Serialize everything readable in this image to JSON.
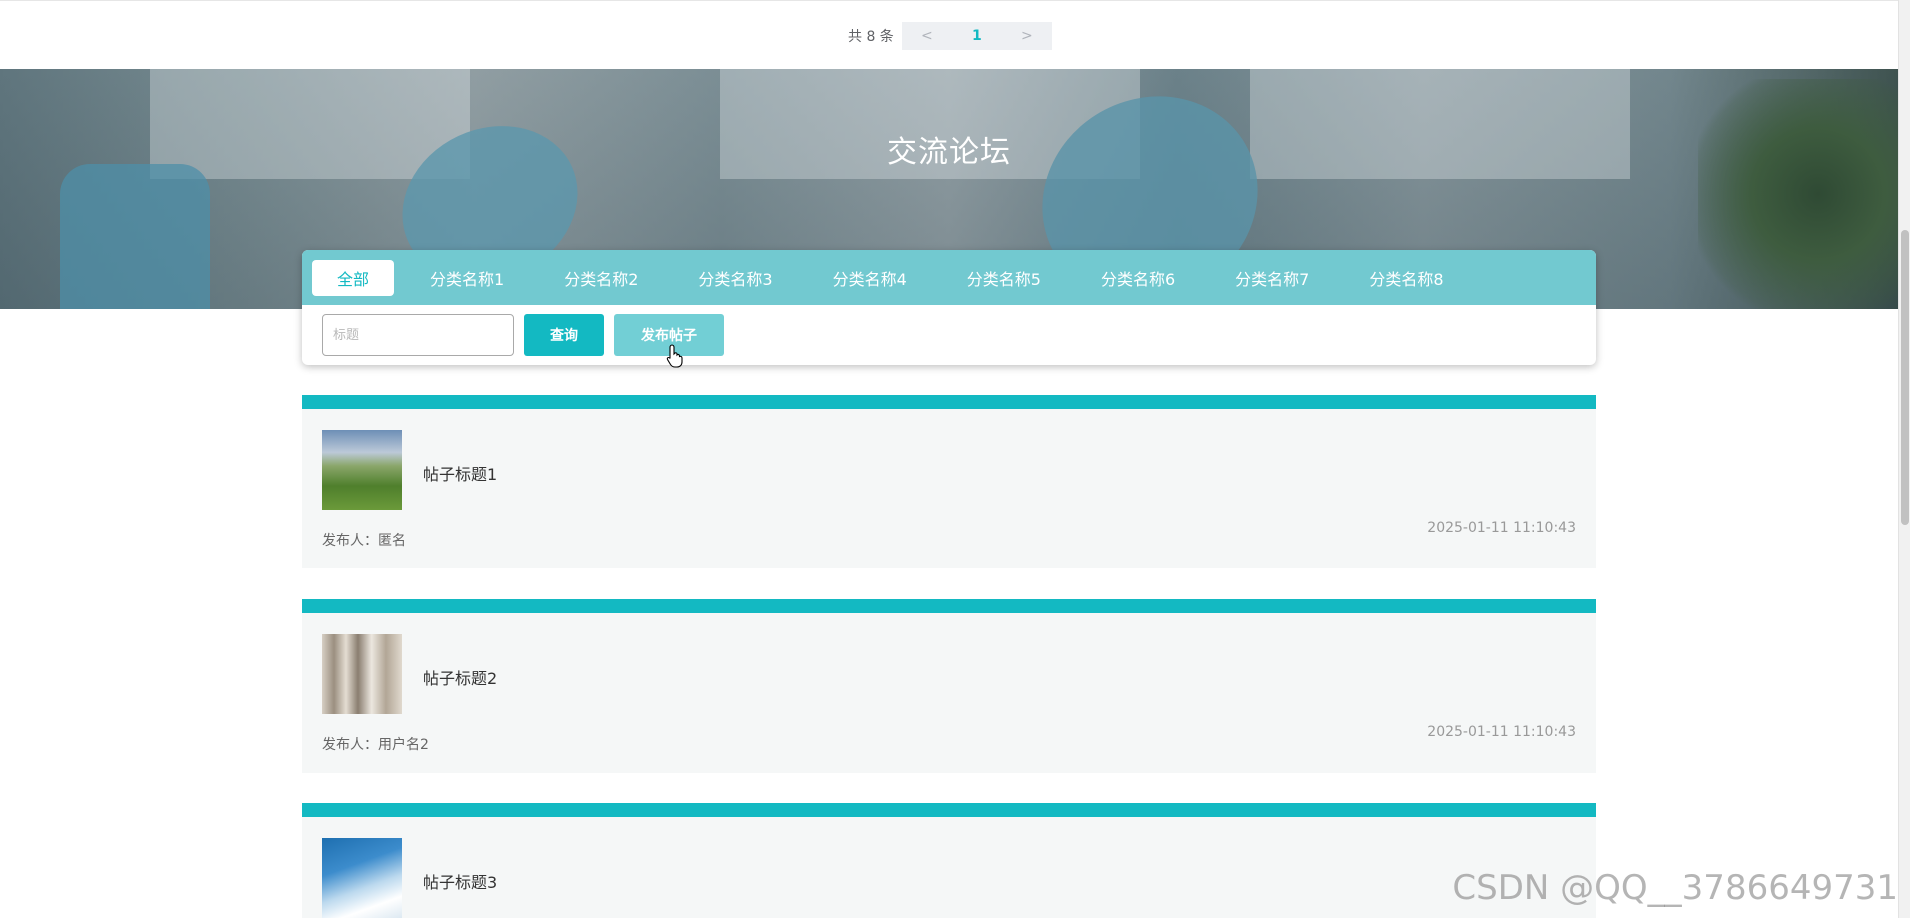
{
  "pagination": {
    "total_text": "共 8 条",
    "prev_label": "<",
    "current_page": "1",
    "next_label": ">"
  },
  "banner": {
    "title": "交流论坛"
  },
  "category_tabs": [
    {
      "label": "全部",
      "active": true
    },
    {
      "label": "分类名称1",
      "active": false
    },
    {
      "label": "分类名称2",
      "active": false
    },
    {
      "label": "分类名称3",
      "active": false
    },
    {
      "label": "分类名称4",
      "active": false
    },
    {
      "label": "分类名称5",
      "active": false
    },
    {
      "label": "分类名称6",
      "active": false
    },
    {
      "label": "分类名称7",
      "active": false
    },
    {
      "label": "分类名称8",
      "active": false
    }
  ],
  "search": {
    "placeholder": "标题",
    "query_button": "查询",
    "post_button": "发布帖子"
  },
  "posts": [
    {
      "title": "帖子标题1",
      "author": "发布人：匿名",
      "time": "2025-01-11 11:10:43"
    },
    {
      "title": "帖子标题2",
      "author": "发布人：用户名2",
      "time": "2025-01-11 11:10:43"
    },
    {
      "title": "帖子标题3",
      "author": "",
      "time": ""
    }
  ],
  "watermark": "CSDN @QQ__3786649731",
  "colors": {
    "accent": "#13b9c2",
    "tab_bar": "#72c9d0",
    "post_bg": "#f5f7f7"
  }
}
